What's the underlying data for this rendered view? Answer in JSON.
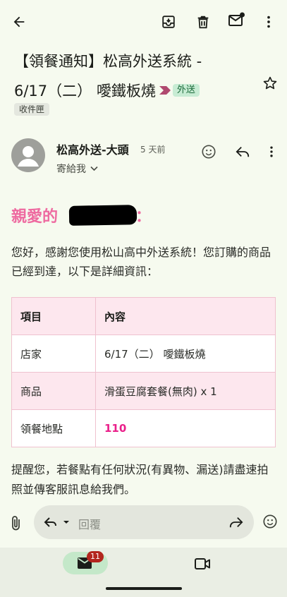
{
  "toolbar": {
    "back_icon": "arrow-left-icon",
    "archive_icon": "archive-icon",
    "delete_icon": "trash-icon",
    "mark_unread_icon": "mail-unread-icon",
    "more_icon": "more-vert-icon"
  },
  "subject": {
    "line1": "【領餐通知】松高外送系統 -",
    "line2": "6/17（二） 噯鐵板燒",
    "label": "外送",
    "folder_chip": "收件匣"
  },
  "sender": {
    "name": "松高外送-大頭",
    "time": "5 天前",
    "to": "寄給我"
  },
  "body": {
    "greeting": "親愛的",
    "greeting_suffix": "：",
    "intro": "您好，感謝您使用松山高中外送系統！您訂購的商品已經到達，以下是詳細資訊：",
    "table": {
      "headers": [
        "項目",
        "內容"
      ],
      "rows": [
        [
          "店家",
          "6/17（二） 噯鐵板燒"
        ],
        [
          "商品",
          "滑蛋豆腐套餐(無肉) x 1"
        ],
        [
          "領餐地點",
          "110"
        ]
      ]
    },
    "reminder": "提醒您，若餐點有任何狀況(有異物、漏送)請盡速拍照並傳客服訊息給我們。"
  },
  "reply": {
    "placeholder": "回覆"
  },
  "bottom_nav": {
    "mail_badge": "11"
  },
  "colors": {
    "accent_pink": "#ee6aa0",
    "highlight_pink": "#ea1f8a",
    "label_green": "#c8ecd4",
    "badge_red": "#b3261e"
  }
}
